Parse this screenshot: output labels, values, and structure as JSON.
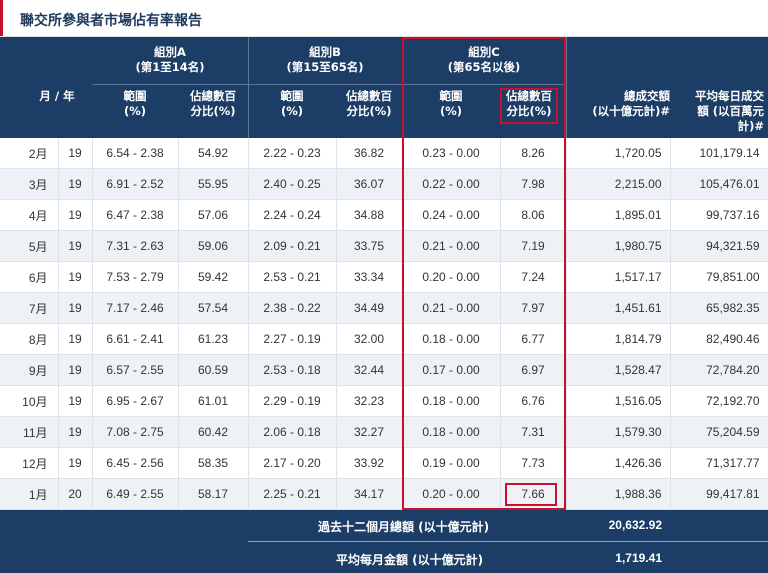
{
  "page_title": "聯交所參與者市場佔有率報告",
  "header": {
    "group_a": "組別A",
    "group_a_sub": "(第1至14名)",
    "group_b": "組別B",
    "group_b_sub": "(第15至65名)",
    "group_c": "組別C",
    "group_c_sub": "(第65名以後)",
    "month_year": "月 / 年",
    "range_label": "範圍",
    "range_unit": "(%)",
    "share_label": "佔總數百",
    "share_unit": "分比(%)",
    "turnover_line1": "總成交額",
    "turnover_line2": "(以十億元計)#",
    "avg_line1": "平均每日成交",
    "avg_line2": "額 (以百萬元",
    "avg_line3": "計)#"
  },
  "rows": [
    {
      "month": "2月",
      "year": "19",
      "a_range": "6.54 - 2.38",
      "a_share": "54.92",
      "b_range": "2.22 - 0.23",
      "b_share": "36.82",
      "c_range": "0.23 - 0.00",
      "c_share": "8.26",
      "turnover": "1,720.05",
      "avg": "101,179.14"
    },
    {
      "month": "3月",
      "year": "19",
      "a_range": "6.91 - 2.52",
      "a_share": "55.95",
      "b_range": "2.40 - 0.25",
      "b_share": "36.07",
      "c_range": "0.22 - 0.00",
      "c_share": "7.98",
      "turnover": "2,215.00",
      "avg": "105,476.01"
    },
    {
      "month": "4月",
      "year": "19",
      "a_range": "6.47 - 2.38",
      "a_share": "57.06",
      "b_range": "2.24 - 0.24",
      "b_share": "34.88",
      "c_range": "0.24 - 0.00",
      "c_share": "8.06",
      "turnover": "1,895.01",
      "avg": "99,737.16"
    },
    {
      "month": "5月",
      "year": "19",
      "a_range": "7.31 - 2.63",
      "a_share": "59.06",
      "b_range": "2.09 - 0.21",
      "b_share": "33.75",
      "c_range": "0.21 - 0.00",
      "c_share": "7.19",
      "turnover": "1,980.75",
      "avg": "94,321.59"
    },
    {
      "month": "6月",
      "year": "19",
      "a_range": "7.53 - 2.79",
      "a_share": "59.42",
      "b_range": "2.53 - 0.21",
      "b_share": "33.34",
      "c_range": "0.20 - 0.00",
      "c_share": "7.24",
      "turnover": "1,517.17",
      "avg": "79,851.00"
    },
    {
      "month": "7月",
      "year": "19",
      "a_range": "7.17 - 2.46",
      "a_share": "57.54",
      "b_range": "2.38 - 0.22",
      "b_share": "34.49",
      "c_range": "0.21 - 0.00",
      "c_share": "7.97",
      "turnover": "1,451.61",
      "avg": "65,982.35"
    },
    {
      "month": "8月",
      "year": "19",
      "a_range": "6.61 - 2.41",
      "a_share": "61.23",
      "b_range": "2.27 - 0.19",
      "b_share": "32.00",
      "c_range": "0.18 - 0.00",
      "c_share": "6.77",
      "turnover": "1,814.79",
      "avg": "82,490.46"
    },
    {
      "month": "9月",
      "year": "19",
      "a_range": "6.57 - 2.55",
      "a_share": "60.59",
      "b_range": "2.53 - 0.18",
      "b_share": "32.44",
      "c_range": "0.17 - 0.00",
      "c_share": "6.97",
      "turnover": "1,528.47",
      "avg": "72,784.20"
    },
    {
      "month": "10月",
      "year": "19",
      "a_range": "6.95 - 2.67",
      "a_share": "61.01",
      "b_range": "2.29 - 0.19",
      "b_share": "32.23",
      "c_range": "0.18 - 0.00",
      "c_share": "6.76",
      "turnover": "1,516.05",
      "avg": "72,192.70"
    },
    {
      "month": "11月",
      "year": "19",
      "a_range": "7.08 - 2.75",
      "a_share": "60.42",
      "b_range": "2.06 - 0.18",
      "b_share": "32.27",
      "c_range": "0.18 - 0.00",
      "c_share": "7.31",
      "turnover": "1,579.30",
      "avg": "75,204.59"
    },
    {
      "month": "12月",
      "year": "19",
      "a_range": "6.45 - 2.56",
      "a_share": "58.35",
      "b_range": "2.17 - 0.20",
      "b_share": "33.92",
      "c_range": "0.19 - 0.00",
      "c_share": "7.73",
      "turnover": "1,426.36",
      "avg": "71,317.77"
    },
    {
      "month": "1月",
      "year": "20",
      "a_range": "6.49 - 2.55",
      "a_share": "58.17",
      "b_range": "2.25 - 0.21",
      "b_share": "34.17",
      "c_range": "0.20 - 0.00",
      "c_share": "7.66",
      "turnover": "1,988.36",
      "avg": "99,417.81"
    }
  ],
  "footer": {
    "total_label": "過去十二個月總額 (以十億元計)",
    "total_value": "20,632.92",
    "avg_label": "平均每月金額 (以十億元計)",
    "avg_value": "1,719.41"
  },
  "colors": {
    "header_bg": "#1c3e66",
    "highlight": "#c8102e",
    "row_alt": "#eef2f7"
  }
}
